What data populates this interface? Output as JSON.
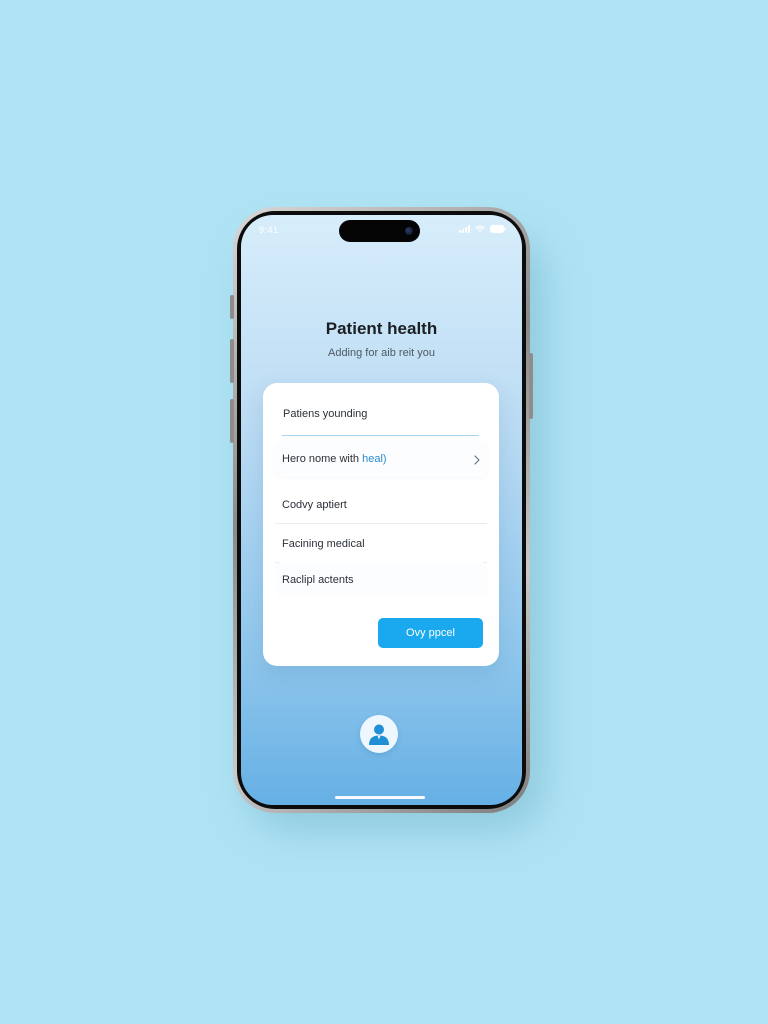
{
  "status_bar": {
    "time": "9:41"
  },
  "header": {
    "title": "Patient health",
    "subtitle": "Adding for aib reit you"
  },
  "card": {
    "input": {
      "value": "Patiens younding"
    },
    "rows": [
      {
        "label_plain": "Hero nome with ",
        "label_accent": "heal)"
      },
      {
        "label": "Codvy aptiert"
      },
      {
        "label": "Facining medical"
      },
      {
        "label": "Raclipl actents"
      }
    ],
    "primary_button": "Ovy ppcel"
  },
  "icons": {
    "row_chevron": "chevron-right-icon",
    "avatar": "user-avatar-icon"
  },
  "colors": {
    "background": "#afe3f4",
    "accent": "#1aa9ee",
    "link": "#2b8bd0"
  }
}
